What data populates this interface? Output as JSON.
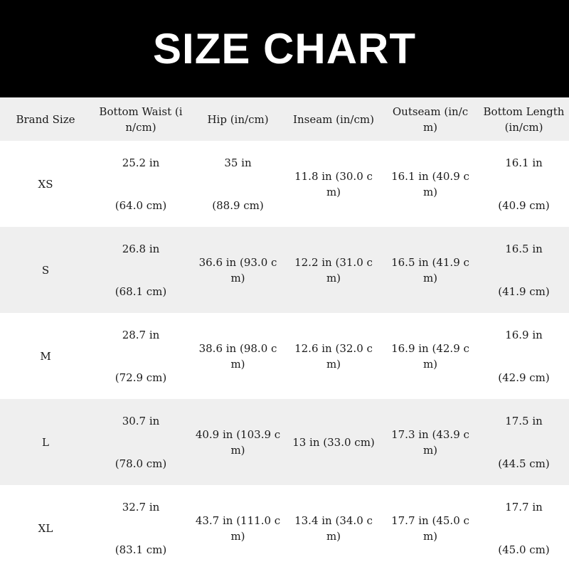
{
  "banner": {
    "title": "SIZE CHART",
    "background": "#000000",
    "text_color": "#ffffff"
  },
  "table": {
    "header_bg": "#efefef",
    "stripe_bg": "#efefef",
    "columns": [
      "Brand Size",
      "Bottom Waist (in/cm)",
      "Hip (in/cm)",
      "Inseam (in/cm)",
      "Outseam (in/cm)",
      "Bottom Length (in/cm)"
    ],
    "rows": [
      {
        "size": "XS",
        "waist_in": "25.2 in",
        "waist_cm": "(64.0 cm)",
        "hip_in": "35 in",
        "hip_cm": "(88.9 cm)",
        "inseam": "11.8 in (30.0 cm)",
        "outseam": "16.1 in (40.9 cm)",
        "length_in": "16.1 in",
        "length_cm": "(40.9 cm)"
      },
      {
        "size": "S",
        "waist_in": "26.8 in",
        "waist_cm": "(68.1 cm)",
        "hip": "36.6 in (93.0 cm)",
        "inseam": "12.2 in (31.0 cm)",
        "outseam": "16.5 in (41.9 cm)",
        "length_in": "16.5 in",
        "length_cm": "(41.9 cm)"
      },
      {
        "size": "M",
        "waist_in": "28.7 in",
        "waist_cm": "(72.9 cm)",
        "hip": "38.6 in (98.0 cm)",
        "inseam": "12.6 in (32.0 cm)",
        "outseam": "16.9 in (42.9 cm)",
        "length_in": "16.9 in",
        "length_cm": "(42.9 cm)"
      },
      {
        "size": "L",
        "waist_in": "30.7 in",
        "waist_cm": "(78.0 cm)",
        "hip": "40.9 in (103.9 cm)",
        "inseam": "13 in (33.0 cm)",
        "outseam": "17.3 in (43.9 cm)",
        "length_in": "17.5 in",
        "length_cm": "(44.5 cm)"
      },
      {
        "size": "XL",
        "waist_in": "32.7 in",
        "waist_cm": "(83.1 cm)",
        "hip": "43.7 in (111.0 cm)",
        "inseam": "13.4 in (34.0 cm)",
        "outseam": "17.7 in (45.0 cm)",
        "length_in": "17.7 in",
        "length_cm": "(45.0 cm)"
      }
    ]
  }
}
